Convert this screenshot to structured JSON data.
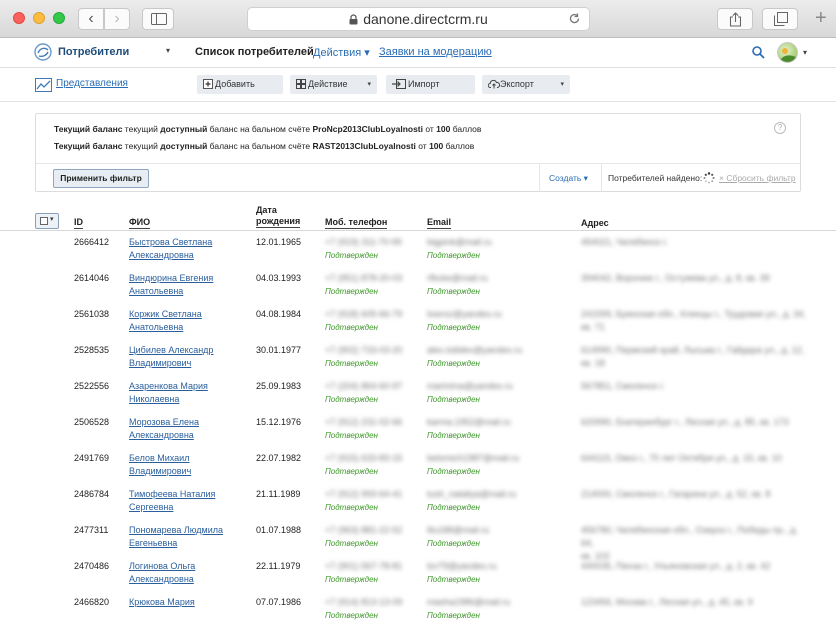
{
  "browser": {
    "url": "danone.directcrm.ru",
    "back_glyph": "‹",
    "forward_glyph": "›",
    "new_tab_glyph": "+"
  },
  "header": {
    "section_title": "Потребители",
    "caret": "▾",
    "page_heading": "Список потребителей",
    "actions_label": "Действия ▾",
    "moderation_label": "Заявки на модерацию"
  },
  "toolbar": {
    "views_label": "Представления",
    "add_label": "Добавить",
    "action_label": "Действие",
    "import_label": "Импорт",
    "export_label": "Экспорт",
    "dropdown_glyph": "▾"
  },
  "filter": {
    "conditions": [
      {
        "part1": "Текущий баланс",
        "part2": " текущий ",
        "part3": "доступный",
        "part4": " баланс на бальном счёте ",
        "part5": "ProNcp2013ClubLoyalnosti",
        "part6": " от ",
        "part7": "100",
        "part8": " баллов"
      },
      {
        "part1": "Текущий баланс",
        "part2": " текущий ",
        "part3": "доступный",
        "part4": " баланс на бальном счёте ",
        "part5": "RAST2013ClubLoyalnosti",
        "part6": " от ",
        "part7": "100",
        "part8": " баллов"
      }
    ],
    "help_glyph": "?",
    "apply_label": "Применить фильтр",
    "create_label": "Создать ▾",
    "found_label": "Потребителей найдено:",
    "reset_label": "× Сбросить фильтр"
  },
  "table": {
    "select_caret": "▾",
    "headers": {
      "id": "ID",
      "name": "ФИО",
      "dob_line1": "Дата",
      "dob_line2": "рождения",
      "phone": "Моб. телефон",
      "email": "Email",
      "address": "Адрес"
    },
    "confirmed_label": "Подтвержден",
    "rows": [
      {
        "id": "2666412",
        "name1": "Быстрова Светлана",
        "name2": "Александровна",
        "dob": "12.01.1965",
        "phone": "+7 (919) 311-70-99",
        "email": "bigpink@mail.ru",
        "addr1": "454021, Челябинск г.",
        "addr2": ""
      },
      {
        "id": "2614046",
        "name1": "Виндюрина Евгения",
        "name2": "Анатольевна",
        "dob": "04.03.1993",
        "phone": "+7 (951) 878-20-03",
        "email": "rfbcke@mail.ru",
        "addr1": "394042, Воронеж г., Остужева ул., д. 8, кв. 39",
        "addr2": ""
      },
      {
        "id": "2561038",
        "name1": "Коржик Светлана",
        "name2": "Анатольевна",
        "dob": "04.08.1984",
        "phone": "+7 (918) 605-66-79",
        "email": "lowroz@yandex.ru",
        "addr1": "241599, Брянская обл., Клинцы г., Трудовая ул., д. 34,",
        "addr2": "кв. 71"
      },
      {
        "id": "2528535",
        "name1": "Цибилев Александр",
        "name2": "Владимирович",
        "dob": "30.01.1977",
        "phone": "+7 (902) 733-03-20",
        "email": "alex.tsibilev@yandex.ru",
        "addr1": "614990, Пермский край, Лысьва г., Гайдара ул., д. 12,",
        "addr2": "кв. 18"
      },
      {
        "id": "2522556",
        "name1": "Азаренкова Мария",
        "name2": "Николаевна",
        "dob": "25.09.1983",
        "phone": "+7 (204) 864-60-97",
        "email": "marinima@yandex.ru",
        "addr1": "567851, Смоленск г.",
        "addr2": ""
      },
      {
        "id": "2506528",
        "name1": "Морозова Елена",
        "name2": "Александровна",
        "dob": "15.12.1976",
        "phone": "+7 (912) 231-02-66",
        "email": "karma.1952@mail.ru",
        "addr1": "620990, Екатеринбург г., Лесная ул., д. 85, кв. 173",
        "addr2": ""
      },
      {
        "id": "2491769",
        "name1": "Белов Михаил",
        "name2": "Владимирович",
        "dob": "22.07.1982",
        "phone": "+7 (915) 633-83-15",
        "email": "belomich1987@mail.ru",
        "addr1": "644115, Омск г., 70 лет Октября ул., д. 15, кв. 10",
        "addr2": ""
      },
      {
        "id": "2486784",
        "name1": "Тимофеева Наталия",
        "name2": "Сергеевна",
        "dob": "21.11.1989",
        "phone": "+7 (912) 993-64-41",
        "email": "tush_nataliya@mail.ru",
        "addr1": "214000, Смоленск г., Гагарина ул., д. 52, кв. 8",
        "addr2": ""
      },
      {
        "id": "2477311",
        "name1": "Пономарева Людмила",
        "name2": "Евгеньевна",
        "dob": "01.07.1988",
        "phone": "+7 (963) 881-22-52",
        "email": "lilu188@mail.ru",
        "addr1": "456780, Челябинская обл., Озерск г., Победы пр., д. 64,",
        "addr2": "кв. 102"
      },
      {
        "id": "2470486",
        "name1": "Логинова Ольга",
        "name2": "Александровна",
        "dob": "22.11.1979",
        "phone": "+7 (901) 567-78-81",
        "email": "lsv79@yandex.ru",
        "addr1": "440035, Пенза г., Ульяновская ул., д. 2, кв. 42",
        "addr2": ""
      },
      {
        "id": "2466820",
        "name1": "Крюкова Мария",
        "name2": "",
        "dob": "07.07.1986",
        "phone": "+7 (914) 813-13-09",
        "email": "masha1986@mail.ru",
        "addr1": "123456, Москва г., Лесная ул., д. 45, кв. 9",
        "addr2": ""
      }
    ]
  }
}
